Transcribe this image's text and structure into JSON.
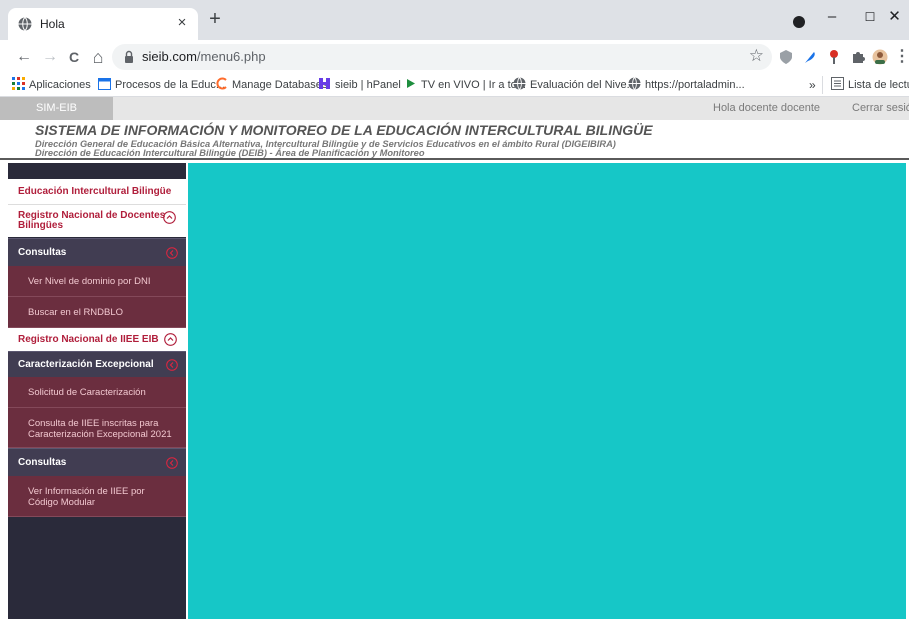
{
  "browser": {
    "tab_title": "Hola",
    "tab_close": "×",
    "new_tab": "+",
    "window_controls": {
      "minimize": "–",
      "maximize": "☐",
      "close": "✕"
    },
    "nav": {
      "back": "←",
      "forward": "→",
      "reload": "C",
      "home": "⌂"
    },
    "url_host": "sieib.com",
    "url_path": "/menu6.php",
    "bookmarks": [
      {
        "label": "Aplicaciones",
        "icon": "apps-grid-icon"
      },
      {
        "label": "Procesos de la Educ...",
        "icon": "calendar-icon"
      },
      {
        "label": "Manage Databases",
        "icon": "cpanel-icon"
      },
      {
        "label": "sieib | hPanel",
        "icon": "hostinger-icon"
      },
      {
        "label": "TV en VIVO | Ir a to...",
        "icon": "play-icon"
      },
      {
        "label": "Evaluación del Nive...",
        "icon": "globe-icon"
      },
      {
        "label": "https://portaladmin...",
        "icon": "globe-icon"
      }
    ],
    "more_bookmarks": "»",
    "reading_list": "Lista de lectura"
  },
  "header": {
    "badge": "SIM-EIB",
    "greeting": "Hola docente docente",
    "logout": "Cerrar sesión",
    "title": "SISTEMA DE INFORMACIÓN Y MONITOREO DE LA EDUCACIÓN INTERCULTURAL BILINGÜE",
    "subtitle1": "Dirección General de Educación Básica Alternativa, Intercultural Bilingüe y de Servicios Educativos en el ámbito Rural (DIGEIBIRA)",
    "subtitle2": "Dirección de Educación Intercultural Bilingüe (DEIB) - Área de Planificación y Monitoreo"
  },
  "sidebar": {
    "eib": "Educación Intercultural Bilingüe",
    "registro_docentes_1": "Registro Nacional de Docentes",
    "registro_docentes_2": "Bilingües",
    "consultas1": "Consultas",
    "ver_nivel": "Ver Nivel de dominio por DNI",
    "buscar": "Buscar en el RNDBLO",
    "registro_iiee": "Registro Nacional de IIEE EIB",
    "caracterizacion": "Caracterización Excepcional",
    "solicitud": "Solicitud de Caracterización",
    "consulta_iiee_1": "Consulta de IIEE inscritas para",
    "consulta_iiee_2": "Caracterización Excepcional 2021",
    "consultas2": "Consultas",
    "ver_info_1": "Ver Información de IIEE por",
    "ver_info_2": "Código Modular"
  },
  "colors": {
    "content_bg": "#16c7c7",
    "sidebar_bg": "#2a2a3a",
    "accent_red": "#b01e3b"
  }
}
